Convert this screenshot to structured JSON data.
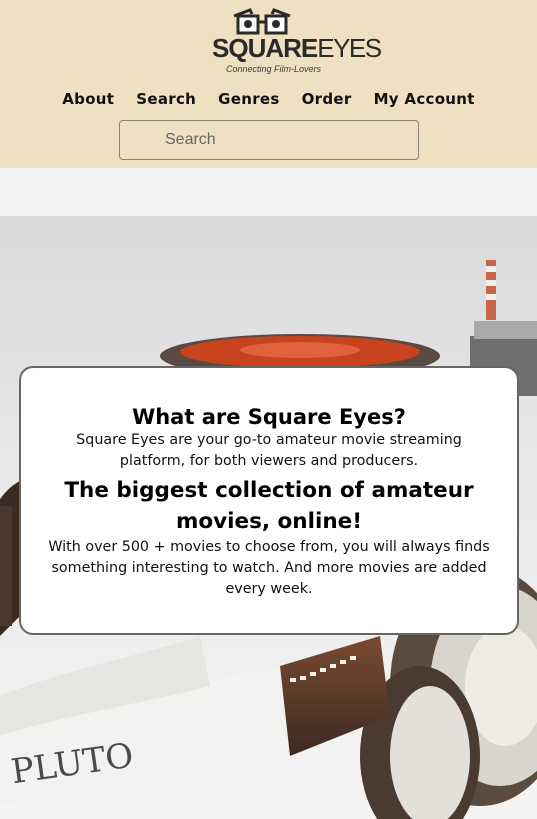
{
  "logo": {
    "word_bold": "SQUARE",
    "word_light": "EYES",
    "tagline": "Connecting Film-Lovers"
  },
  "nav": {
    "items": [
      "About",
      "Search",
      "Genres",
      "Order",
      "My Account"
    ]
  },
  "search": {
    "placeholder": "Search"
  },
  "hero_card": {
    "heading1": "What are Square Eyes?",
    "text1": "Square Eyes are your go-to amateur movie streaming platform, for both viewers and producers.",
    "heading2": "The biggest collection of amateur movies, online!",
    "text2": "With over 500 + movies to choose from, you will always finds something interesting to watch. And more movies are added every week."
  },
  "colors": {
    "header_bg": "#efe0c2",
    "strip_bg": "#f1f1f1",
    "film_reel_orange": "#c7431e"
  },
  "hero_image": {
    "film_strip_text": "PLUTO"
  }
}
